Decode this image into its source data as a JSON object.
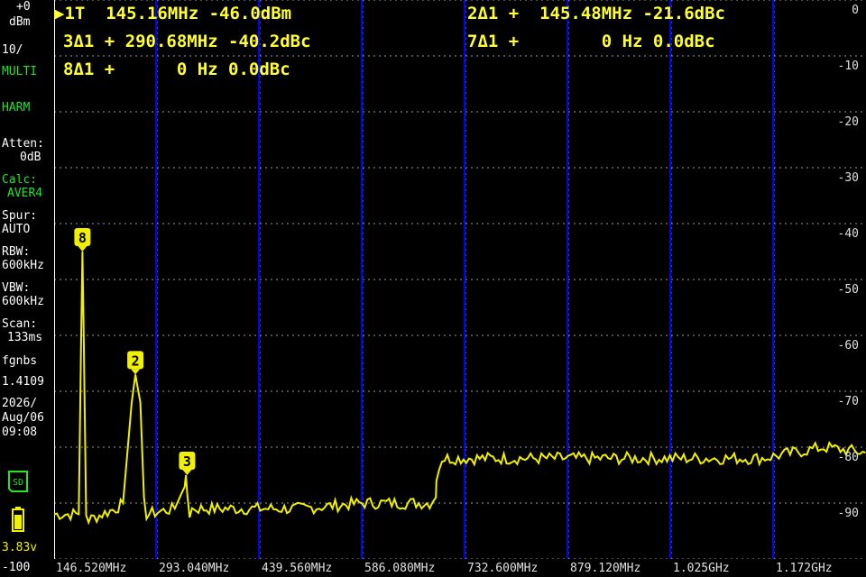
{
  "sidebar": {
    "ref_value": "+0",
    "ref_unit": "dBm",
    "scale": "10/",
    "mode1": "MULTI",
    "mode2": "HARM",
    "atten_label": "Atten:",
    "atten_value": "0dB",
    "calc_label": "Calc:",
    "calc_value": "AVER4",
    "spur_label": "Spur:",
    "spur_value": "AUTO",
    "rbw_label": "RBW:",
    "rbw_value": "600kHz",
    "vbw_label": "VBW:",
    "vbw_value": "600kHz",
    "scan_label": "Scan:",
    "scan_value": "133ms",
    "fw_label": "fgnbs",
    "fw_value": "1.4109",
    "date": "2026/",
    "date2": "Aug/06",
    "time": "09:08",
    "sd_label": "SD",
    "battery_voltage": "3.83v",
    "bottom_value": "-100"
  },
  "markers": [
    {
      "text": "▶1T  145.16MHz -46.0dBm"
    },
    {
      "text": "2Δ1 +  145.48MHz -21.6dBc"
    },
    {
      "text": "3Δ1 + 290.68MHz -40.2dBc"
    },
    {
      "text": "7Δ1 +        0 Hz 0.0dBc"
    },
    {
      "text": "8Δ1 +      0 Hz 0.0dBc"
    }
  ],
  "chart_data": {
    "type": "line",
    "ylim": [
      -100,
      0
    ],
    "xlim": [
      0,
      1318.68
    ],
    "yticks": [
      "0",
      "-10",
      "-20",
      "-30",
      "-40",
      "-50",
      "-60",
      "-70",
      "-80",
      "-90"
    ],
    "xticks": [
      "146.520MHz",
      "293.040MHz",
      "439.560MHz",
      "586.080MHz",
      "732.600MHz",
      "879.120MHz",
      "1.025GHz",
      "1.172GHz"
    ],
    "series": [
      {
        "values_x": [
          0,
          40,
          44,
          46,
          48,
          52,
          56,
          100,
          112,
          126,
          132,
          140,
          146,
          150,
          196,
          212,
          214,
          216,
          220,
          224,
          230,
          400,
          500,
          610,
          620,
          621,
          630,
          700,
          800,
          900,
          1000,
          1050,
          1100,
          1150,
          1200,
          1250,
          1318
        ],
        "values_y": [
          -92,
          -92,
          -60,
          -45,
          -60,
          -92,
          -93,
          -91,
          -90,
          -72,
          -67,
          -72,
          -90,
          -92,
          -91,
          -87,
          -85,
          -88,
          -92,
          -91,
          -91,
          -91,
          -90,
          -90,
          -89,
          -86,
          -82,
          -82,
          -82,
          -82,
          -82,
          -82,
          -82,
          -82,
          -81,
          -80,
          -81
        ]
      }
    ],
    "point_markers": [
      {
        "label": "8",
        "x": 46,
        "y": -45
      },
      {
        "label": "2",
        "x": 132,
        "y": -67
      },
      {
        "label": "3",
        "x": 216,
        "y": -85
      }
    ],
    "colors": {
      "trace": "#f0f000",
      "grid": "#9a9a9a",
      "axis": "#ffffff",
      "vline": "#0000ff"
    }
  }
}
